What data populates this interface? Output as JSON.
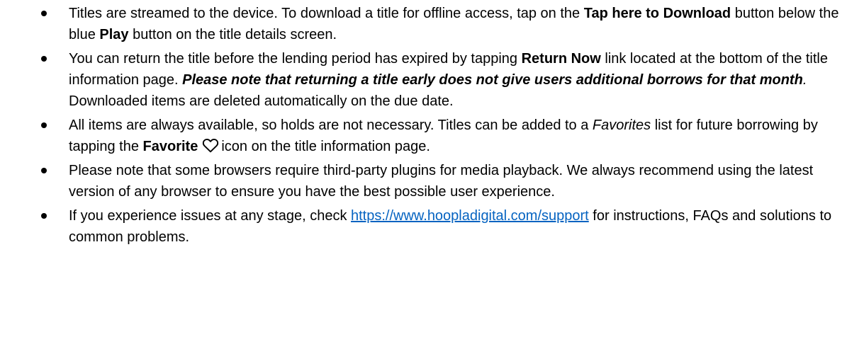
{
  "bullets": {
    "b1": {
      "t1": "Titles are streamed to the device. To download a title for offline access, tap on the ",
      "t2": "Tap here to Download",
      "t3": " button below the blue ",
      "t4": "Play",
      "t5": " button on the title details screen."
    },
    "b2": {
      "t1": "You can return the title before the lending period has expired by tapping ",
      "t2": "Return Now",
      "t3": " link located at the bottom of the title information page. ",
      "t4": "Please note that returning a title early does not give users additional borrows for that month",
      "t5": ".",
      "t6": " Downloaded items are deleted automatically on the due date."
    },
    "b3": {
      "t1": "All items are always available, so holds are not necessary. Titles can be added to a ",
      "t2": "Favorites",
      "t3": " list for future borrowing by tapping the ",
      "t4": "Favorite",
      "icon": "heart-outline-icon",
      "t5": "icon on the title information page."
    },
    "b4": {
      "t1": "Please note that some browsers require third-party plugins for media playback. We always recommend using the latest version of any browser to ensure you have the best possible user experience."
    },
    "b5": {
      "t1": "If you experience issues at any stage, check ",
      "link": "https://www.hoopladigital.com/support",
      "t2": " for instructions, FAQs and solutions to common problems."
    }
  },
  "colors": {
    "text": "#000000",
    "link": "#0563c1"
  }
}
